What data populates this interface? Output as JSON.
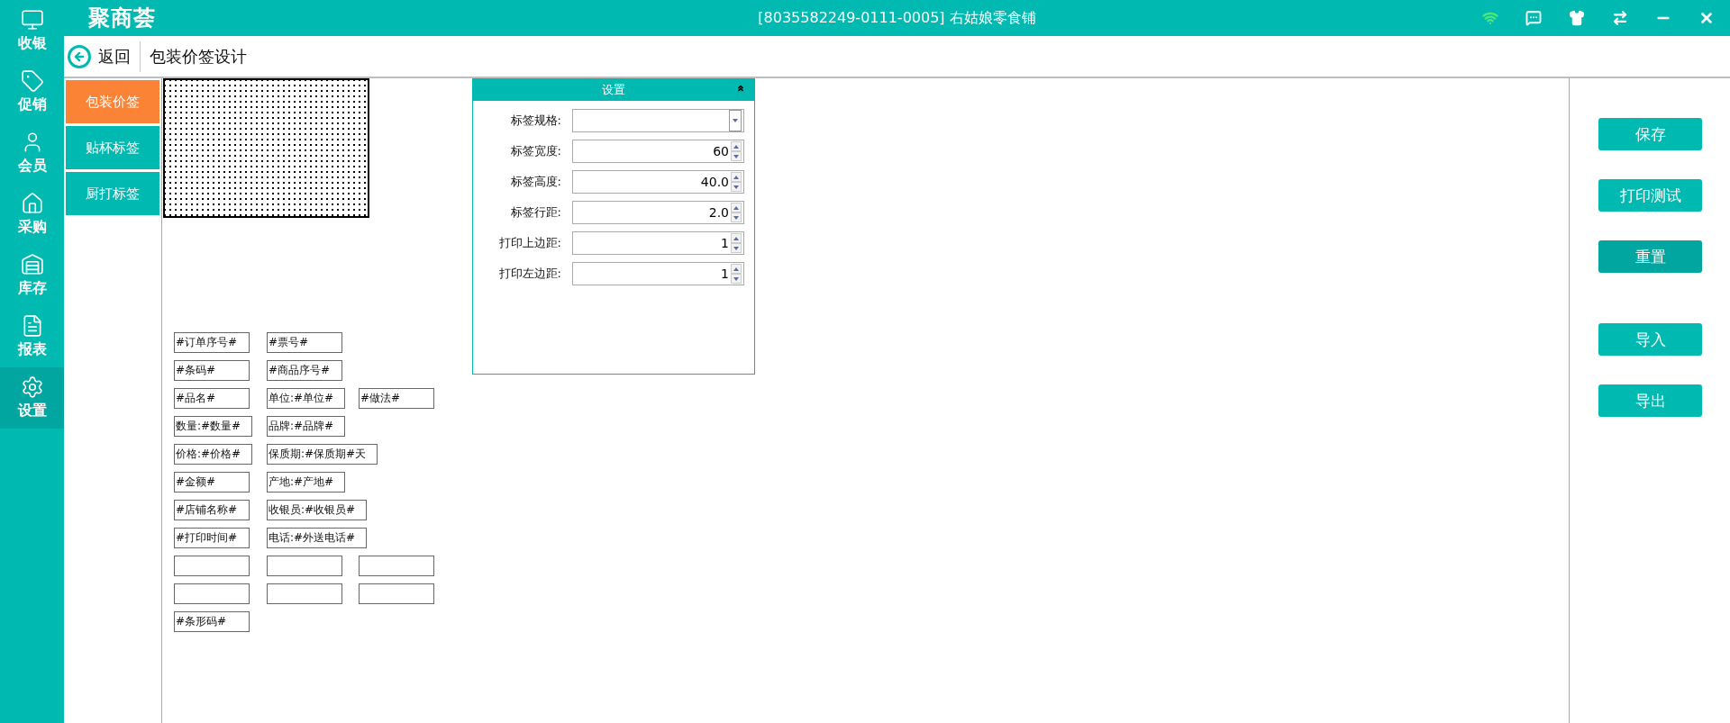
{
  "sidebar": {
    "items": [
      {
        "kind": "cashier",
        "label": "收银",
        "selected": false
      },
      {
        "kind": "promo",
        "label": "促销",
        "selected": false
      },
      {
        "kind": "member",
        "label": "会员",
        "selected": false
      },
      {
        "kind": "purchase",
        "label": "采购",
        "selected": false
      },
      {
        "kind": "stock",
        "label": "库存",
        "selected": false
      },
      {
        "kind": "report",
        "label": "报表",
        "selected": false
      },
      {
        "kind": "settings",
        "label": "设置",
        "selected": true
      }
    ]
  },
  "top_bar": {
    "logo": "聚商荟",
    "title": "[8035582249-0111-0005] 右姑娘零食铺"
  },
  "header": {
    "back_label": "返回",
    "title": "包装价签设计"
  },
  "tabs": [
    {
      "label": "包装价签",
      "selected": true
    },
    {
      "label": "贴杯标签",
      "selected": false
    },
    {
      "label": "厨打标签",
      "selected": false
    }
  ],
  "settings": {
    "title": "设置",
    "fields": [
      {
        "kind": "select",
        "label": "标签规格:"
      },
      {
        "kind": "spin",
        "label": "标签宽度:",
        "value": "60"
      },
      {
        "kind": "spin",
        "label": "标签高度:",
        "value": "40.0"
      },
      {
        "kind": "spin",
        "label": "标签行距:",
        "value": "2.0"
      },
      {
        "kind": "spin",
        "label": "打印上边距:",
        "value": "1"
      },
      {
        "kind": "spin",
        "label": "打印左边距:",
        "value": "1"
      }
    ]
  },
  "template_fields": [
    [
      {
        "kind": "field",
        "text": "#订单序号#"
      },
      {
        "kind": "field",
        "text": "#票号#"
      }
    ],
    [
      {
        "kind": "field",
        "text": "#条码#"
      },
      {
        "kind": "field",
        "text": "#商品序号#"
      }
    ],
    [
      {
        "kind": "field",
        "text": "#品名#"
      },
      {
        "kind": "field",
        "text": "单位:#单位#"
      },
      {
        "kind": "field",
        "text": "#做法#"
      }
    ],
    [
      {
        "kind": "field",
        "text": "数量:#数量#"
      },
      {
        "kind": "field",
        "text": "品牌:#品牌#"
      }
    ],
    [
      {
        "kind": "field",
        "text": "价格:#价格#"
      },
      {
        "kind": "field",
        "text": "保质期:#保质期#天"
      }
    ],
    [
      {
        "kind": "field",
        "text": "#金额#"
      },
      {
        "kind": "field",
        "text": "产地:#产地#"
      }
    ],
    [
      {
        "kind": "field",
        "text": "#店铺名称#"
      },
      {
        "kind": "field",
        "text": "收银员:#收银员#"
      }
    ],
    [
      {
        "kind": "field",
        "text": "#打印时间#"
      },
      {
        "kind": "field",
        "text": "电话:#外送电话#"
      }
    ],
    [
      {
        "kind": "blank"
      },
      {
        "kind": "blank"
      },
      {
        "kind": "blank"
      }
    ],
    [
      {
        "kind": "blank"
      },
      {
        "kind": "blank"
      },
      {
        "kind": "blank"
      }
    ],
    [
      {
        "kind": "field",
        "text": "#条形码#"
      }
    ]
  ],
  "action_groups": [
    [
      {
        "label": "保存",
        "active": false
      },
      {
        "label": "打印测试",
        "active": false
      },
      {
        "label": "重置",
        "active": true
      }
    ],
    [
      {
        "label": "导入",
        "active": false
      },
      {
        "label": "导出",
        "active": false
      }
    ]
  ]
}
